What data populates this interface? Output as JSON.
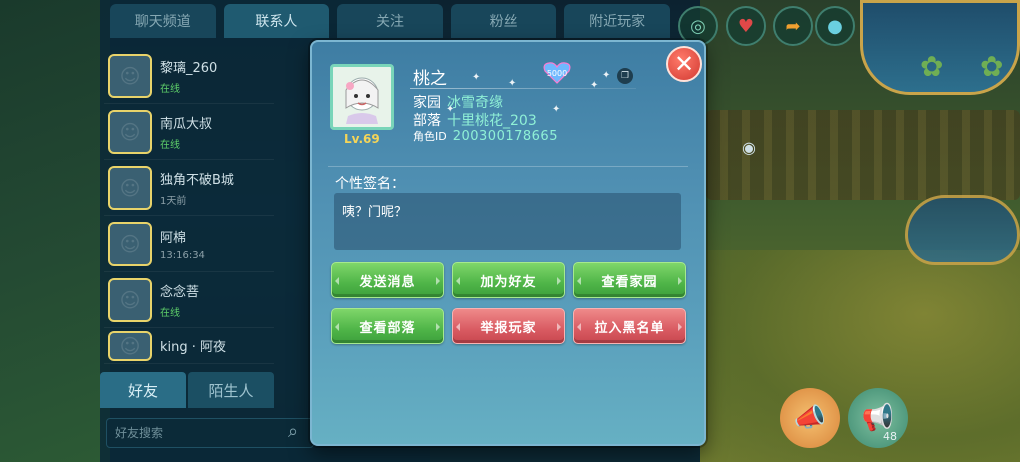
{
  "top_tabs": [
    "聊天频道",
    "联系人",
    "关注",
    "粉丝",
    "附近玩家"
  ],
  "friends": [
    {
      "name": "黎璃_260",
      "status": "在线"
    },
    {
      "name": "南瓜大叔",
      "status": "在线"
    },
    {
      "name": "独角不破B城",
      "status": "1天前"
    },
    {
      "name": "阿棉",
      "status": "13:16:34"
    },
    {
      "name": "念念菩",
      "status": "在线"
    },
    {
      "name": "king · 阿夜",
      "status": ""
    }
  ],
  "bottom_tabs": {
    "friends": "好友",
    "strangers": "陌生人"
  },
  "search": {
    "placeholder": "好友搜索"
  },
  "action_bubble": {
    "count": "48"
  },
  "profile": {
    "name": "桃之",
    "level": "Lv.69",
    "badge_text": "5000",
    "home_label": "家园",
    "home_value": "冰雪奇缘",
    "tribe_label": "部落",
    "tribe_value": "十里桃花_203",
    "id_label": "角色ID",
    "id_value": "200300178665"
  },
  "signature": {
    "label": "个性签名：",
    "text": "咦？门呢？"
  },
  "buttons": {
    "send_message": "发送消息",
    "add_friend": "加为好友",
    "view_home": "查看家园",
    "view_tribe": "查看部落",
    "report_player": "举报玩家",
    "block_player": "拉入黑名单"
  },
  "colors": {
    "green_button": "#4fb548",
    "red_button": "#d95b62",
    "accent_text": "#8ff0d6",
    "level_gold": "#f5d558"
  },
  "icons": {
    "close": "close-icon",
    "copy": "copy-icon",
    "search": "search-icon",
    "heart_badge": "heart-badge-icon"
  }
}
